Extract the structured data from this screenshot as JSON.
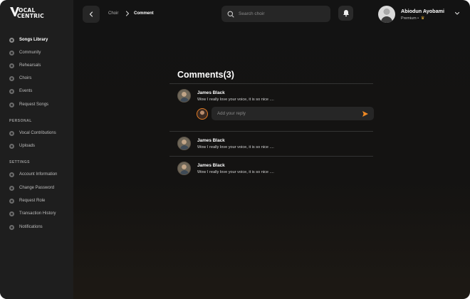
{
  "app": {
    "logo_line1": "OCAL",
    "logo_line2": "CENTRIC"
  },
  "sidebar": {
    "main_items": [
      {
        "label": "Songs Library",
        "active": true
      },
      {
        "label": "Community"
      },
      {
        "label": "Rehearsals"
      },
      {
        "label": "Choirs"
      },
      {
        "label": "Events"
      },
      {
        "label": "Request Songs"
      }
    ],
    "personal_heading": "PERSONAL",
    "personal_items": [
      {
        "label": "Vocal Contributions"
      },
      {
        "label": "Uploads"
      }
    ],
    "settings_heading": "SETTINGS",
    "settings_items": [
      {
        "label": "Account Information"
      },
      {
        "label": "Change Password"
      },
      {
        "label": "Request Role"
      },
      {
        "label": "Transaction History"
      },
      {
        "label": "Notifications"
      }
    ]
  },
  "header": {
    "breadcrumb": [
      "Choir",
      "Comment"
    ],
    "search_placeholder": "Search choir",
    "user_name": "Abiodun Ayobami",
    "user_tier": "Premium •"
  },
  "comments": {
    "title": "Comments(3)",
    "items": [
      {
        "author": "James Black",
        "text": "Wow I really love your voice, it is so nice ...."
      },
      {
        "author": "James Black",
        "text": "Wow I really love your voice, it is so nice ...."
      },
      {
        "author": "James Black",
        "text": "Wow I really love your voice, it is so nice ...."
      }
    ],
    "reply_placeholder": "Add your reply"
  },
  "colors": {
    "accent": "#f08a24",
    "background": "#131313",
    "sidebar": "#1e1e1e"
  },
  "icons": {
    "back": "chevron-left-icon",
    "search": "search-icon",
    "bell": "bell-icon",
    "dropdown": "chevron-down-icon",
    "send": "send-icon",
    "crown": "crown-icon"
  }
}
